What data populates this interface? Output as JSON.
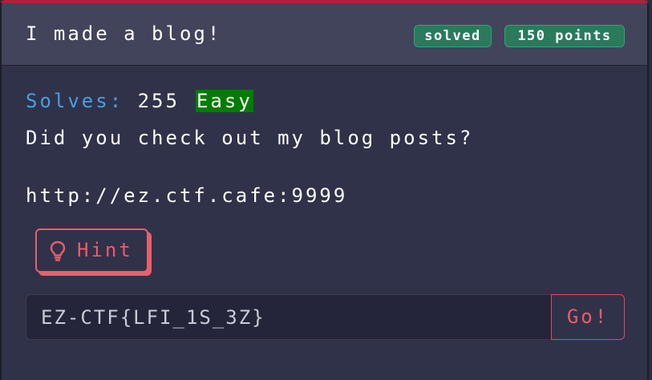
{
  "challenge": {
    "title": "I made a blog!",
    "badges": {
      "solved": "solved",
      "points": "150 points"
    },
    "solves_label": "Solves:",
    "solves_count": "255",
    "difficulty": "Easy",
    "description": "Did you check out my blog posts?",
    "link": "http://ez.ctf.cafe:9999",
    "hint_label": "Hint",
    "hint_icon": "lightbulb-icon",
    "flag_value": "EZ-CTF{LFI_1S_3Z}",
    "submit_label": "Go!"
  },
  "colors": {
    "accent_top": "#b02036",
    "badge_green": "#2a7a5c",
    "solves_label_blue": "#4a9ee0",
    "difficulty_green": "#007d00",
    "hint_red": "#ee5a6a"
  }
}
